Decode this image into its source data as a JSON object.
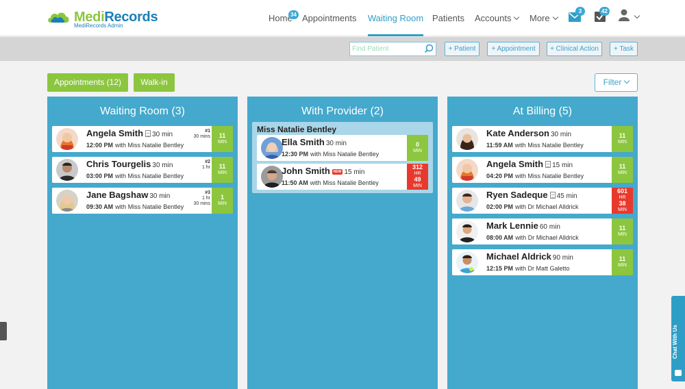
{
  "brand": {
    "name_part1": "Medi",
    "name_part2": "Records",
    "subtitle": "MediRecords Admin"
  },
  "nav": {
    "home": "Home",
    "home_badge": "34",
    "appointments": "Appointments",
    "waiting_room": "Waiting Room",
    "patients": "Patients",
    "accounts": "Accounts",
    "more": "More",
    "messages_badge": "3",
    "tasks_badge": "42"
  },
  "actionbar": {
    "search_placeholder": "Find Patient",
    "add_patient": "+ Patient",
    "add_appointment": "+ Appointment",
    "add_clinical_action": "+ Clinical Action",
    "add_task": "+ Task"
  },
  "buttons": {
    "appointments": "Appointments (12)",
    "walkin": "Walk-in",
    "filter": "Filter"
  },
  "columns": {
    "waiting": {
      "title": "Waiting Room (3)",
      "cards": [
        {
          "name": "Angela Smith",
          "duration": "30 min",
          "time": "12:00 PM",
          "with": "with Miss Natalie Bentley",
          "queue": "#1",
          "queue_sub": "30 mins",
          "wait": "11",
          "wait_unit": "MIN"
        },
        {
          "name": "Chris Tourgelis",
          "duration": "30 min",
          "time": "03:00 PM",
          "with": "with Miss Natalie Bentley",
          "queue": "#2",
          "queue_sub": "1 hr",
          "wait": "11",
          "wait_unit": "MIN"
        },
        {
          "name": "Jane Bagshaw",
          "duration": "30 min",
          "time": "09:30 AM",
          "with": "with Miss Natalie Bentley",
          "queue": "#3",
          "queue_sub": "1 hr 30 mins",
          "queue_sub1": "1 hr",
          "queue_sub2": "30 mins",
          "wait": "1",
          "wait_unit": "MIN"
        }
      ]
    },
    "provider": {
      "title": "With Provider (2)",
      "group_title": "Miss Natalie Bentley",
      "cards": [
        {
          "name": "Ella Smith",
          "duration": "30 min",
          "time": "12:30 PM",
          "with": "with Miss Natalie Bentley",
          "wait": "0",
          "wait_unit": "MIN"
        },
        {
          "name": "John Smith",
          "new_tag": "NEW",
          "duration": "15 min",
          "time": "11:50 AM",
          "with": "with Miss Natalie Bentley",
          "wait_hr": "312",
          "wait_hr_unit": "HR",
          "wait_min": "49",
          "wait_min_unit": "MIN"
        }
      ]
    },
    "billing": {
      "title": "At Billing (5)",
      "cards": [
        {
          "name": "Kate Anderson",
          "duration": "30 min",
          "time": "11:59 AM",
          "with": "with Miss Natalie Bentley",
          "wait": "11",
          "wait_unit": "MIN"
        },
        {
          "name": "Angela Smith",
          "duration": "15 min",
          "time": "04:20 PM",
          "with": "with Miss Natalie Bentley",
          "wait": "11",
          "wait_unit": "MIN"
        },
        {
          "name": "Ryen Sadeque",
          "duration": "45 min",
          "time": "02:00 PM",
          "with": "with Dr Michael Alldrick",
          "wait_hr": "601",
          "wait_hr_unit": "HR",
          "wait_min": "38",
          "wait_min_unit": "MIN"
        },
        {
          "name": "Mark Lennie",
          "duration": "60 min",
          "time": "08:00 AM",
          "with": "with Dr Michael Alldrick",
          "wait": "11",
          "wait_unit": "MIN"
        },
        {
          "name": "Michael Aldrick",
          "duration": "90 min",
          "time": "12:15 PM",
          "with": "with Dr Matt Galetto",
          "wait": "11",
          "wait_unit": "MIN"
        }
      ]
    }
  },
  "chat": {
    "label": "Chat With Us"
  },
  "colors": {
    "accent": "#44a9cc",
    "green": "#8cc63f",
    "alert": "#e8392e"
  }
}
